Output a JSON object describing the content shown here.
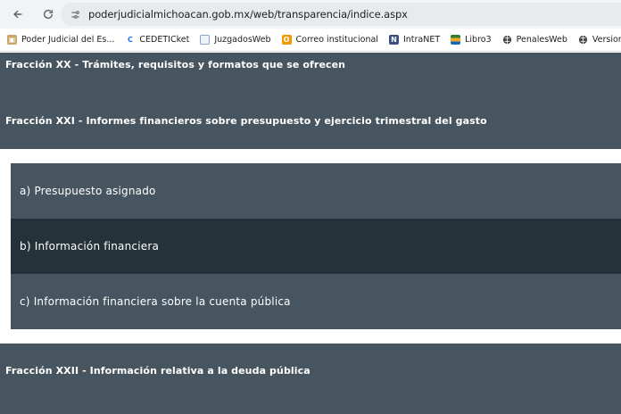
{
  "browser": {
    "url": "poderjudicialmichoacan.gob.mx/web/transparencia/indice.aspx",
    "bookmarks": [
      {
        "label": "Poder Judicial del Es...",
        "icon": "pj-logo-icon",
        "color": "#8a6d3b"
      },
      {
        "label": "CEDETICket",
        "icon": "cedeticket-logo-icon",
        "color": "#1a73e8"
      },
      {
        "label": "JuzgadosWeb",
        "icon": "document-icon",
        "color": "#4a6fa5"
      },
      {
        "label": "Correo institucional",
        "icon": "mail-icon",
        "color": "#f29900"
      },
      {
        "label": "IntraNET",
        "icon": "intranet-icon",
        "color": "#3c4f80"
      },
      {
        "label": "Libro3",
        "icon": "books-icon",
        "color": "#2e7d32"
      },
      {
        "label": "PenalesWeb",
        "icon": "globe-icon",
        "color": "#444444"
      },
      {
        "label": "Versiones Públic",
        "icon": "globe-icon",
        "color": "#444444"
      }
    ]
  },
  "content": {
    "fraccion_xx": "Fracción XX - Trámites, requisitos y formatos que se ofrecen",
    "fraccion_xxi": "Fracción XXI - Informes financieros sobre presupuesto y ejercicio trimestral del gasto",
    "sub_items": [
      "a) Presupuesto asignado",
      "b) Información financiera",
      "c) Información financiera sobre la cuenta pública"
    ],
    "fraccion_xxii": "Fracción XXII - Información relativa a la deuda pública"
  }
}
